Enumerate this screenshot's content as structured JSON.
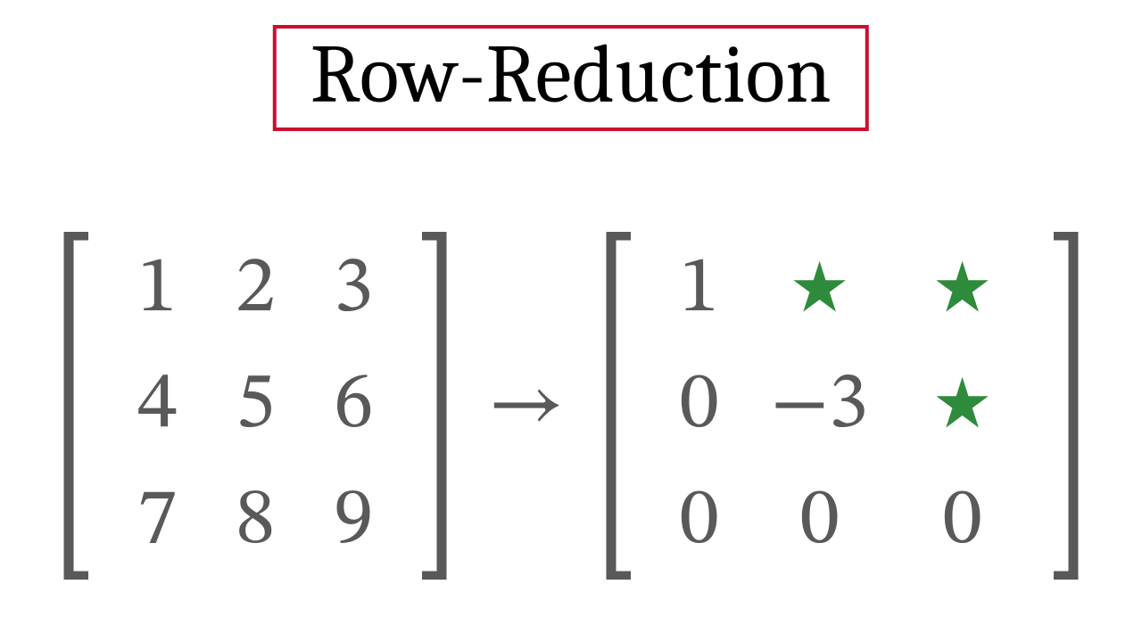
{
  "title": "Row-Reduction",
  "arrow": "→",
  "colors": {
    "border": "#c8102e",
    "digit": "#595959",
    "star": "#2e8b3c"
  },
  "matrix_left": {
    "rows": 3,
    "cols": 3,
    "cells": [
      [
        {
          "text": "1"
        },
        {
          "text": "2"
        },
        {
          "text": "3"
        }
      ],
      [
        {
          "text": "4"
        },
        {
          "text": "5"
        },
        {
          "text": "6"
        }
      ],
      [
        {
          "text": "7"
        },
        {
          "text": "8"
        },
        {
          "text": "9"
        }
      ]
    ]
  },
  "matrix_right": {
    "rows": 3,
    "cols": 3,
    "cells": [
      [
        {
          "text": "1"
        },
        {
          "text": "⋆",
          "star": true
        },
        {
          "text": "⋆",
          "star": true
        }
      ],
      [
        {
          "text": "0"
        },
        {
          "text": "−3",
          "minus": true
        },
        {
          "text": "⋆",
          "star": true
        }
      ],
      [
        {
          "text": "0"
        },
        {
          "text": "0"
        },
        {
          "text": "0"
        }
      ]
    ]
  }
}
